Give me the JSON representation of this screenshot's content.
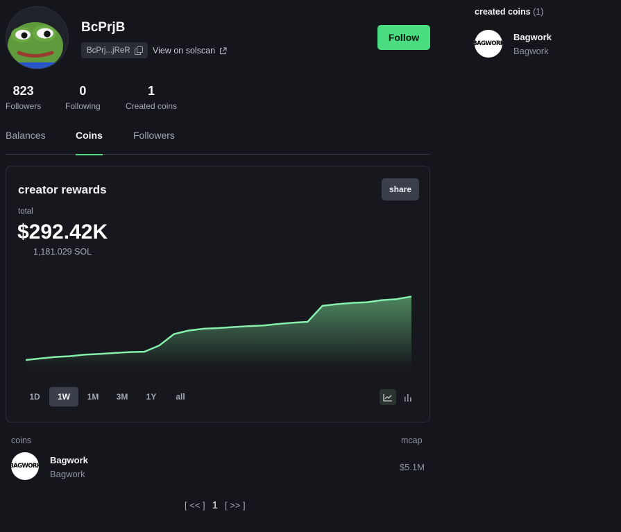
{
  "profile": {
    "username": "BcPrjB",
    "address_short": "BcPrj...jReR",
    "solscan_label": "View on solscan",
    "follow_label": "Follow"
  },
  "stats": {
    "followers": {
      "value": "823",
      "label": "Followers"
    },
    "following": {
      "value": "0",
      "label": "Following"
    },
    "created": {
      "value": "1",
      "label": "Created coins"
    }
  },
  "tabs": [
    {
      "label": "Balances"
    },
    {
      "label": "Coins"
    },
    {
      "label": "Followers"
    }
  ],
  "active_tab": "Coins",
  "rewards": {
    "title": "creator rewards",
    "share_label": "share",
    "total_label": "total",
    "total_usd": "$292.42K",
    "total_sol": "1,181.029 SOL",
    "ranges": [
      "1D",
      "1W",
      "1M",
      "3M",
      "1Y",
      "all"
    ],
    "active_range": "1W"
  },
  "chart_data": {
    "type": "area",
    "title": "",
    "xlabel": "",
    "ylabel": "",
    "grid": false,
    "y": [
      5,
      6,
      7,
      7.5,
      8.5,
      9,
      9.6,
      10.2,
      10.4,
      14.5,
      22,
      24.3,
      25.5,
      25.9,
      26.6,
      27.2,
      27.6,
      28.6,
      29.4,
      30,
      40.5,
      41.6,
      42.4,
      42.8,
      44.2,
      44.9,
      46.6
    ],
    "ylim": [
      0,
      60
    ],
    "line_color": "#86efac",
    "fill_top": "#4f8a62",
    "fill_bottom": "#17181d"
  },
  "coins_list": {
    "header_coins": "coins",
    "header_mcap": "mcap",
    "items": [
      {
        "name": "Bagwork",
        "ticker": "Bagwork",
        "logo_text": "BAGWORK",
        "mcap": "$5.1M"
      }
    ]
  },
  "pagination": {
    "prev": "[ << ]",
    "current": "1",
    "next": "[ >> ]"
  },
  "sidebar": {
    "title": "created coins",
    "count": "(1)",
    "items": [
      {
        "name": "Bagwork",
        "ticker": "Bagwork",
        "logo_text": "BAGWORK"
      }
    ]
  },
  "colors": {
    "accent": "#4ade80",
    "background": "#15161b"
  }
}
